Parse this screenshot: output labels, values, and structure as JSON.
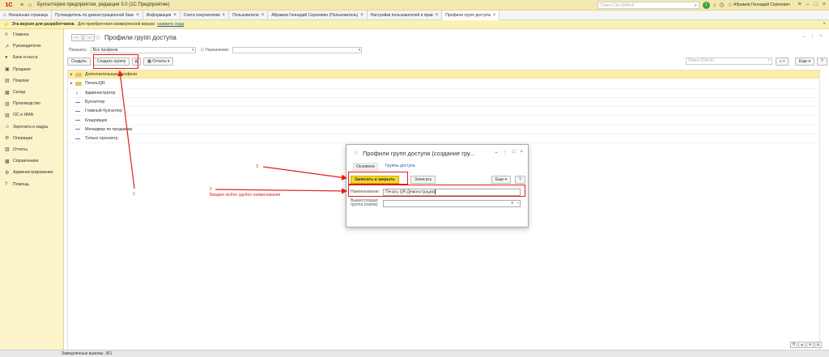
{
  "titlebar": {
    "logo": "1С",
    "title": "Бухгалтерия предприятия, редакция 3.0  (1С:Предприятие)",
    "search_placeholder": "Поиск Ctrl+Shift+F",
    "notification_count": "1",
    "user_name": "Абрамов Геннадий Сергеевич"
  },
  "tabs": [
    {
      "label": "Начальная страница"
    },
    {
      "label": "Путеводитель по демонстрационной базе"
    },
    {
      "label": "Информация"
    },
    {
      "label": "Счета покупателям"
    },
    {
      "label": "Пользователи"
    },
    {
      "label": "Абрамов Геннадий Сергеевич (Пользователь)"
    },
    {
      "label": "Настройки пользователей и прав"
    },
    {
      "label": "Профили групп доступа"
    }
  ],
  "warning": {
    "bold": "Эта версия для разработчиков.",
    "text": "Для приобретения коммерческой версии",
    "link": "нажмите сюда"
  },
  "sidebar": {
    "items": [
      {
        "label": "Главное",
        "icon": "menu-icon"
      },
      {
        "label": "Руководителю",
        "icon": "chart-icon"
      },
      {
        "label": "Банк и касса",
        "icon": "coins-icon"
      },
      {
        "label": "Продажи",
        "icon": "cart-icon"
      },
      {
        "label": "Покупки",
        "icon": "basket-icon"
      },
      {
        "label": "Склад",
        "icon": "warehouse-icon"
      },
      {
        "label": "Производство",
        "icon": "factory-icon"
      },
      {
        "label": "ОС и НМА",
        "icon": "building-icon"
      },
      {
        "label": "Зарплата и кадры",
        "icon": "people-icon"
      },
      {
        "label": "Операции",
        "icon": "gear-icon"
      },
      {
        "label": "Отчеты",
        "icon": "report-icon"
      },
      {
        "label": "Справочники",
        "icon": "book-icon"
      },
      {
        "label": "Администрирование",
        "icon": "settings-icon"
      },
      {
        "label": "Помощь",
        "icon": "help-icon"
      }
    ]
  },
  "main": {
    "title": "Профили групп доступа",
    "filter": {
      "show_label": "Показать:",
      "show_value": "Все профили",
      "purpose_label": "Назначение:",
      "purpose_value": ""
    },
    "toolbar": {
      "create": "Создать",
      "create_group": "Создать группу",
      "reports": "Отчеты",
      "search_placeholder": "Поиск (Ctrl+F)",
      "more": "Еще",
      "help": "?"
    },
    "rows": [
      {
        "label": "Дополнительные профили",
        "kind": "folder-expandable"
      },
      {
        "label": "ПечатьQR",
        "kind": "folder-expandable"
      },
      {
        "label": "Администратор",
        "kind": "key"
      },
      {
        "label": "Бухгалтер",
        "kind": "item"
      },
      {
        "label": "Главный бухгалтер",
        "kind": "item"
      },
      {
        "label": "Кладовщик",
        "kind": "item"
      },
      {
        "label": "Менеджер по продажам",
        "kind": "item"
      },
      {
        "label": "Только просмотр",
        "kind": "item"
      }
    ]
  },
  "dialog": {
    "title": "Профили групп доступа (создание гру...",
    "tab_main": "Основное",
    "tab_groups": "Группы доступа",
    "save_close": "Записать и закрыть",
    "save": "Записать",
    "more": "Еще",
    "help": "?",
    "name_label": "Наименование:",
    "name_value": "Печать QR Демонстрация",
    "parent_label": "Вышестоящая группа (папка):",
    "parent_value": ""
  },
  "annotations": {
    "step1": "1",
    "step2": "2",
    "step2_text": "Вводим любое удобно наименование",
    "step3": "3",
    "color": "#e11d1d"
  },
  "status": {
    "text": "Замедленные вызовы: 361"
  }
}
